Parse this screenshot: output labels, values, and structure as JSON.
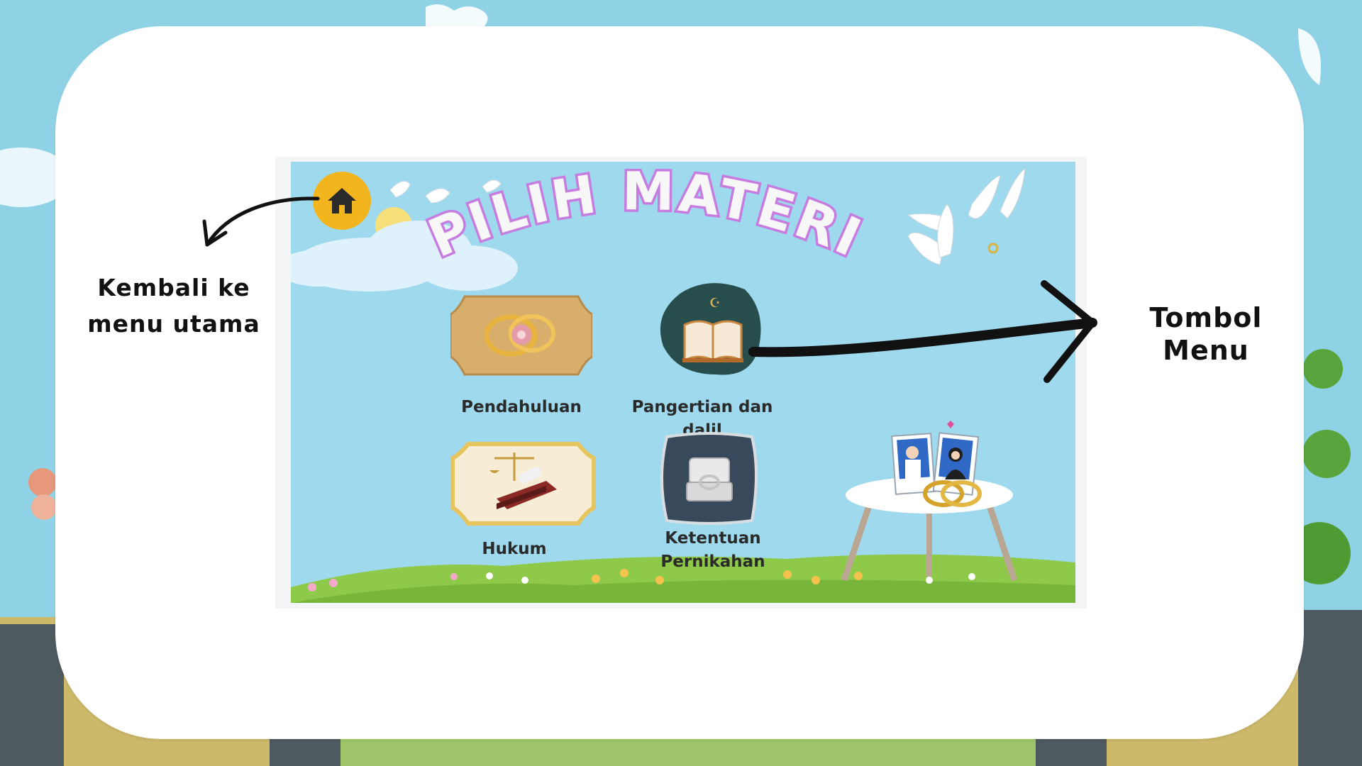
{
  "screen": {
    "title": "PILIH MATERI",
    "home_icon": "home-icon",
    "menu_items": [
      {
        "label": "Pendahuluan",
        "icon": "wedding-rings-icon"
      },
      {
        "label": "Pangertian dan dalil",
        "icon": "quran-book-icon"
      },
      {
        "label": "Hukum",
        "icon": "scales-of-justice-icon"
      },
      {
        "label": "Ketentuan Pernikahan",
        "icon": "ring-box-icon"
      }
    ]
  },
  "annotations": {
    "left_note": "Kembali ke menu utama",
    "right_note": "Tombol Menu"
  },
  "colors": {
    "sky": "#9ed9ee",
    "home_button": "#f2b51d",
    "title_fill": "#f7f7f7",
    "title_outline": "#c77ce0",
    "card_white": "#ffffff"
  }
}
